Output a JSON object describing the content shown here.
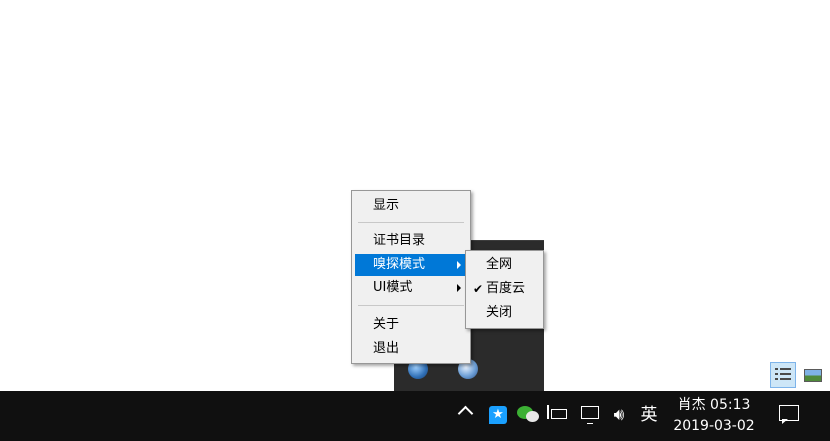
{
  "context_menu": {
    "items": [
      {
        "label": "显示"
      },
      {
        "label": "证书目录"
      },
      {
        "label": "嗅探模式",
        "highlighted": true,
        "has_submenu": true
      },
      {
        "label": "UI模式",
        "has_submenu": true
      },
      {
        "label": "关于"
      },
      {
        "label": "退出"
      }
    ]
  },
  "sniff_submenu": {
    "items": [
      {
        "label": "全网",
        "checked": false
      },
      {
        "label": "百度云",
        "checked": true
      },
      {
        "label": "关闭",
        "checked": false
      }
    ],
    "check_glyph": "✔"
  },
  "view_buttons": {
    "list_view": "list-view-icon",
    "thumbnail_view": "thumbnail-view-icon"
  },
  "taskbar": {
    "input_method": "英",
    "clock_line1": "肖杰 05:13",
    "clock_line2": "2019-03-02",
    "qq_glyph": "★",
    "speaker_glyph": "🔊︎",
    "icons": [
      "show-hidden-icons-chevron",
      "qq-icon",
      "wechat-icon",
      "battery-icon",
      "network-icon",
      "volume-icon",
      "notification-icon"
    ]
  },
  "colors": {
    "highlight": "#0078d7",
    "taskbar": "#101010",
    "menu_bg": "#f0f0f0"
  }
}
